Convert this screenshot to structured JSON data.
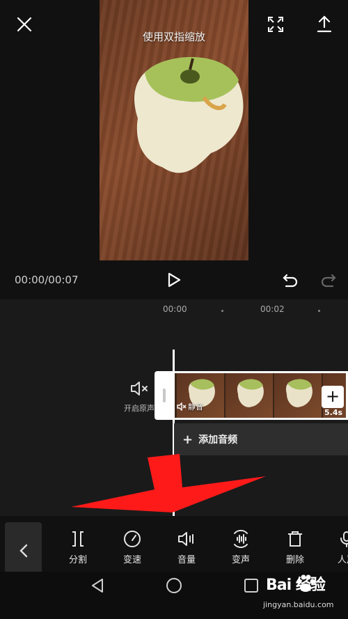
{
  "preview": {
    "hint": "使用双指缩放",
    "time": "00:00/00:07"
  },
  "timeline": {
    "ruler": [
      "00:00",
      "00:02"
    ],
    "mute_label": "开启原声",
    "clip_mute_label": "静音",
    "clip_duration": "5.4s",
    "add_audio_label": "添加音频"
  },
  "toolbar": {
    "items": [
      {
        "label": "分割",
        "icon": "split-icon"
      },
      {
        "label": "变速",
        "icon": "speed-icon"
      },
      {
        "label": "音量",
        "icon": "volume-icon"
      },
      {
        "label": "变声",
        "icon": "voice-change-icon"
      },
      {
        "label": "删除",
        "icon": "delete-icon"
      },
      {
        "label": "人声",
        "icon": "vocal-icon"
      }
    ]
  },
  "watermark": {
    "logo": "Bai  经验",
    "url": "jingyan.baidu.com"
  },
  "colors": {
    "background": "#111111",
    "annotation_arrow": "#ff1a1a"
  }
}
